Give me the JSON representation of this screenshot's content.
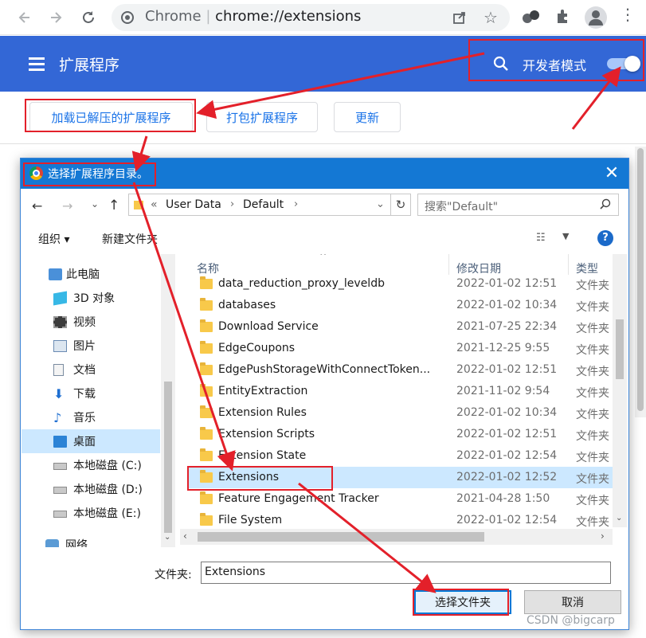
{
  "browser": {
    "omnibox": {
      "site": "Chrome",
      "separator": "|",
      "url": "chrome://extensions"
    }
  },
  "extensions_page": {
    "title": "扩展程序",
    "developer_mode_label": "开发者模式",
    "developer_mode_on": true,
    "buttons": {
      "load_unpacked": "加载已解压的扩展程序",
      "pack": "打包扩展程序",
      "update": "更新"
    }
  },
  "dialog": {
    "title": "选择扩展程序目录。",
    "breadcrumb": {
      "prefix": "«",
      "items": [
        "User Data",
        "Default"
      ]
    },
    "search_placeholder": "搜索\"Default\"",
    "toolbar": {
      "organize": "组织 ▾",
      "new_folder": "新建文件夹"
    },
    "nav_items": [
      {
        "label": "此电脑",
        "icon": "pc-icon"
      },
      {
        "label": "3D 对象",
        "icon": "cube-icon"
      },
      {
        "label": "视频",
        "icon": "film-icon"
      },
      {
        "label": "图片",
        "icon": "picture-icon"
      },
      {
        "label": "文档",
        "icon": "document-icon"
      },
      {
        "label": "下载",
        "icon": "download-icon"
      },
      {
        "label": "音乐",
        "icon": "music-icon"
      },
      {
        "label": "桌面",
        "icon": "desktop-icon"
      },
      {
        "label": "本地磁盘 (C:)",
        "icon": "drive-c-icon"
      },
      {
        "label": "本地磁盘 (D:)",
        "icon": "drive-icon"
      },
      {
        "label": "本地磁盘 (E:)",
        "icon": "drive-icon"
      },
      {
        "label": "网络",
        "icon": "network-icon"
      }
    ],
    "columns": {
      "name": "名称",
      "modified": "修改日期",
      "type": "类型"
    },
    "files": [
      {
        "name": "data_reduction_proxy_leveldb",
        "modified": "2022-01-02 12:51",
        "type": "文件夹"
      },
      {
        "name": "databases",
        "modified": "2022-01-02 10:34",
        "type": "文件夹"
      },
      {
        "name": "Download Service",
        "modified": "2021-07-25 22:34",
        "type": "文件夹"
      },
      {
        "name": "EdgeCoupons",
        "modified": "2021-12-25 9:55",
        "type": "文件夹"
      },
      {
        "name": "EdgePushStorageWithConnectToken...",
        "modified": "2022-01-02 12:51",
        "type": "文件夹"
      },
      {
        "name": "EntityExtraction",
        "modified": "2021-11-02 9:54",
        "type": "文件夹"
      },
      {
        "name": "Extension Rules",
        "modified": "2022-01-02 10:34",
        "type": "文件夹"
      },
      {
        "name": "Extension Scripts",
        "modified": "2022-01-02 12:51",
        "type": "文件夹"
      },
      {
        "name": "Extension State",
        "modified": "2022-01-02 12:54",
        "type": "文件夹"
      },
      {
        "name": "Extensions",
        "modified": "2022-01-02 12:52",
        "type": "文件夹"
      },
      {
        "name": "Feature Engagement Tracker",
        "modified": "2021-04-28 1:50",
        "type": "文件夹"
      },
      {
        "name": "File System",
        "modified": "2022-01-02 12:54",
        "type": "文件夹"
      }
    ],
    "selected_file": "Extensions",
    "folder_label": "文件夹:",
    "folder_value": "Extensions",
    "buttons": {
      "select": "选择文件夹",
      "cancel": "取消"
    }
  },
  "watermark": "CSDN @bigcarp",
  "colors": {
    "header_blue": "#3367d6",
    "title_blue": "#1478d4",
    "annotation_red": "#e3202a",
    "selection": "#cce8ff"
  }
}
